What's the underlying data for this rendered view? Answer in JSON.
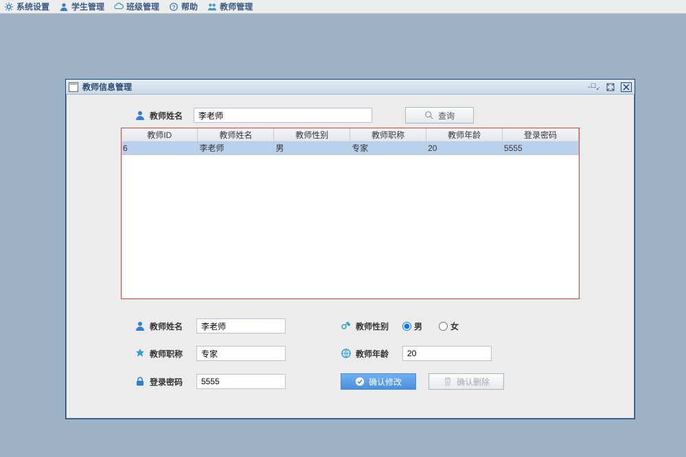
{
  "menubar": {
    "items": [
      {
        "label": "系统设置"
      },
      {
        "label": "学生管理"
      },
      {
        "label": "班级管理"
      },
      {
        "label": "帮助"
      },
      {
        "label": "教师管理"
      }
    ]
  },
  "window": {
    "title": "教师信息管理"
  },
  "search": {
    "label": "教师姓名",
    "value": "李老师",
    "button_label": "查询"
  },
  "table": {
    "columns": [
      "教师ID",
      "教师姓名",
      "教师性别",
      "教师职称",
      "教师年龄",
      "登录密码"
    ],
    "rows": [
      {
        "id": "6",
        "name": "李老师",
        "gender": "男",
        "title": "专家",
        "age": "20",
        "password": "5555"
      }
    ]
  },
  "form": {
    "name_label": "教师姓名",
    "name_value": "李老师",
    "gender_label": "教师性别",
    "gender_male": "男",
    "gender_female": "女",
    "gender_selected": "男",
    "title_label": "教师职称",
    "title_value": "专家",
    "age_label": "教师年龄",
    "age_value": "20",
    "password_label": "登录密码",
    "password_value": "5555",
    "confirm_modify": "确认修改",
    "confirm_delete": "确认删除"
  }
}
